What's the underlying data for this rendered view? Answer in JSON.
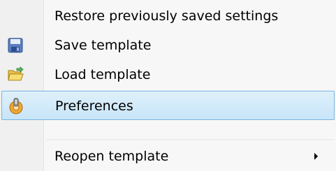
{
  "menu": {
    "items": [
      {
        "label": "Restore previously saved settings",
        "icon": null
      },
      {
        "label": "Save template",
        "icon": "floppy-disk-icon"
      },
      {
        "label": "Load template",
        "icon": "open-folder-icon"
      },
      {
        "label": "Preferences",
        "icon": "preferences-icon",
        "highlighted": true
      },
      {
        "label": "Reopen template",
        "icon": null,
        "submenu": true
      }
    ]
  },
  "colors": {
    "highlight_fill": "#cde8f8",
    "highlight_border": "#7ab4e0",
    "menu_background": "#f7f7f7"
  }
}
